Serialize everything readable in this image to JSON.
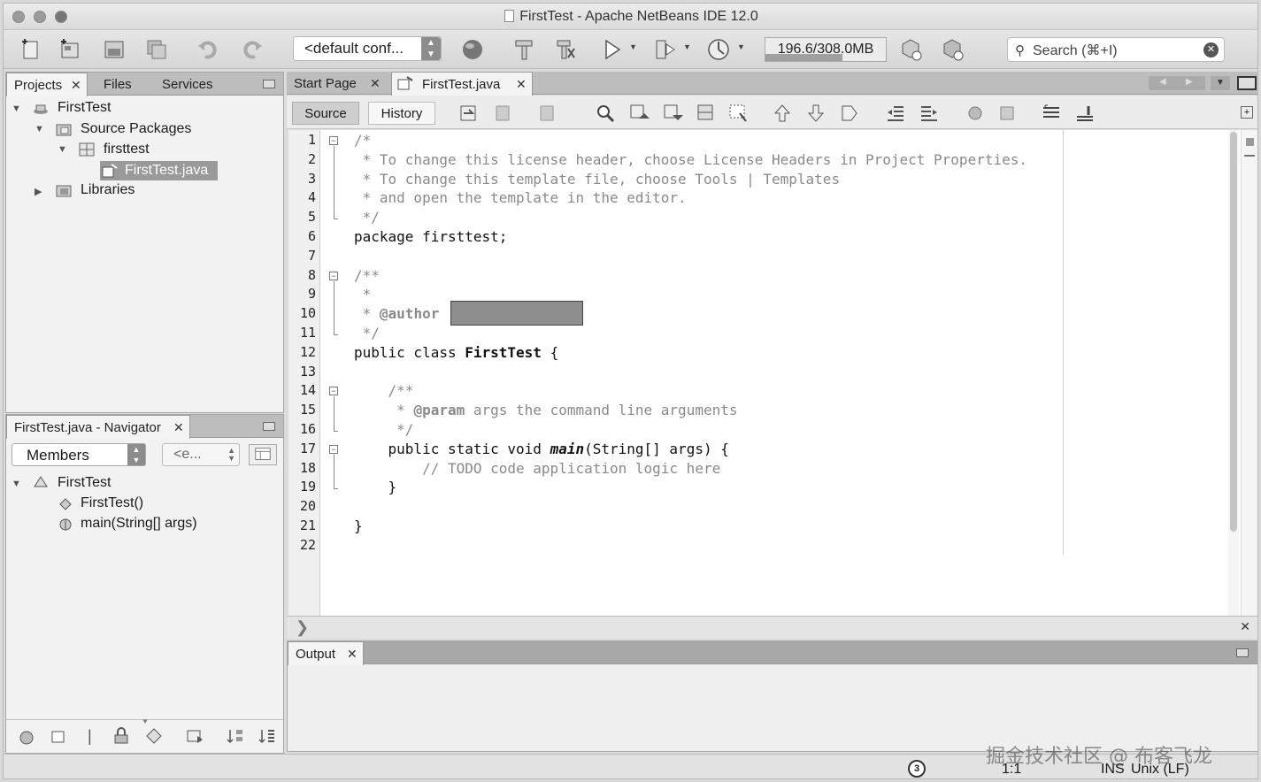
{
  "window": {
    "title": "FirstTest - Apache NetBeans IDE 12.0"
  },
  "toolbar": {
    "config_value": "<default conf...",
    "memory_text": "196.6/308.0MB",
    "memory_fraction": 0.64,
    "search_placeholder": "Search (⌘+I)"
  },
  "projects_panel": {
    "tabs": [
      "Projects",
      "Files",
      "Services"
    ],
    "tree": [
      {
        "label": "FirstTest",
        "level": 0,
        "expanded": true
      },
      {
        "label": "Source Packages",
        "level": 1,
        "expanded": true
      },
      {
        "label": "firsttest",
        "level": 2,
        "expanded": true
      },
      {
        "label": "FirstTest.java",
        "level": 3,
        "selected": true
      },
      {
        "label": "Libraries",
        "level": 1,
        "expanded": false
      }
    ]
  },
  "navigator": {
    "title": "FirstTest.java - Navigator",
    "members_label": "Members",
    "filter_label": "<e...",
    "tree": [
      {
        "label": "FirstTest"
      },
      {
        "label": "FirstTest()"
      },
      {
        "label": "main(String[] args)"
      }
    ]
  },
  "editor": {
    "tabs": [
      "Start Page",
      "FirstTest.java"
    ],
    "source_label": "Source",
    "history_label": "History",
    "lines": [
      "/*",
      " * To change this license header, choose License Headers in Project Properties.",
      " * To change this template file, choose Tools | Templates",
      " * and open the template in the editor.",
      " */",
      "package firsttest;",
      "",
      "/**",
      " *",
      " * @author",
      " */",
      "public class FirstTest {",
      "",
      "    /**",
      "     * @param args the command line arguments",
      "     */",
      "    public static void main(String[] args) {",
      "        // TODO code application logic here",
      "    }",
      "",
      "}",
      ""
    ]
  },
  "output": {
    "tab_label": "Output"
  },
  "status": {
    "position": "1:1",
    "mode": "INS",
    "line_ending": "Unix (LF)",
    "notifications": "3",
    "watermark": "掘金技术社区 @ 布客飞龙"
  }
}
